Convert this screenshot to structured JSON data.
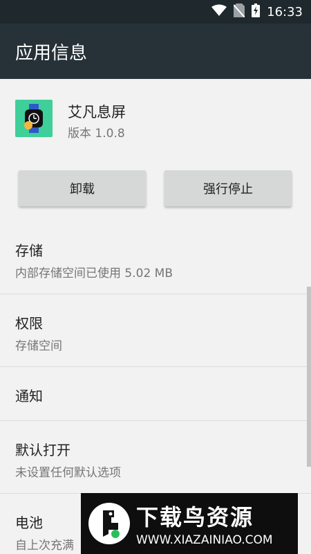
{
  "status_bar": {
    "time": "16:33",
    "icons": [
      "wifi-icon",
      "no-sim-icon",
      "battery-charging-icon"
    ]
  },
  "app_bar": {
    "title": "应用信息"
  },
  "app": {
    "name": "艾凡息屏",
    "version": "版本 1.0.8",
    "icon": "watch-icon",
    "icon_color": "#3fcf9a"
  },
  "buttons": {
    "uninstall": "卸载",
    "force_stop": "强行停止"
  },
  "items": [
    {
      "title": "存储",
      "subtitle": "内部存储空间已使用 5.02 MB"
    },
    {
      "title": "权限",
      "subtitle": "存储空间"
    },
    {
      "title": "通知",
      "subtitle": ""
    },
    {
      "title": "默认打开",
      "subtitle": "未设置任何默认选项"
    },
    {
      "title": "电池",
      "subtitle": "自上次充满"
    }
  ],
  "watermark": {
    "title": "下载鸟资源",
    "url": "WWW.XIAZAINIAO.COM"
  }
}
